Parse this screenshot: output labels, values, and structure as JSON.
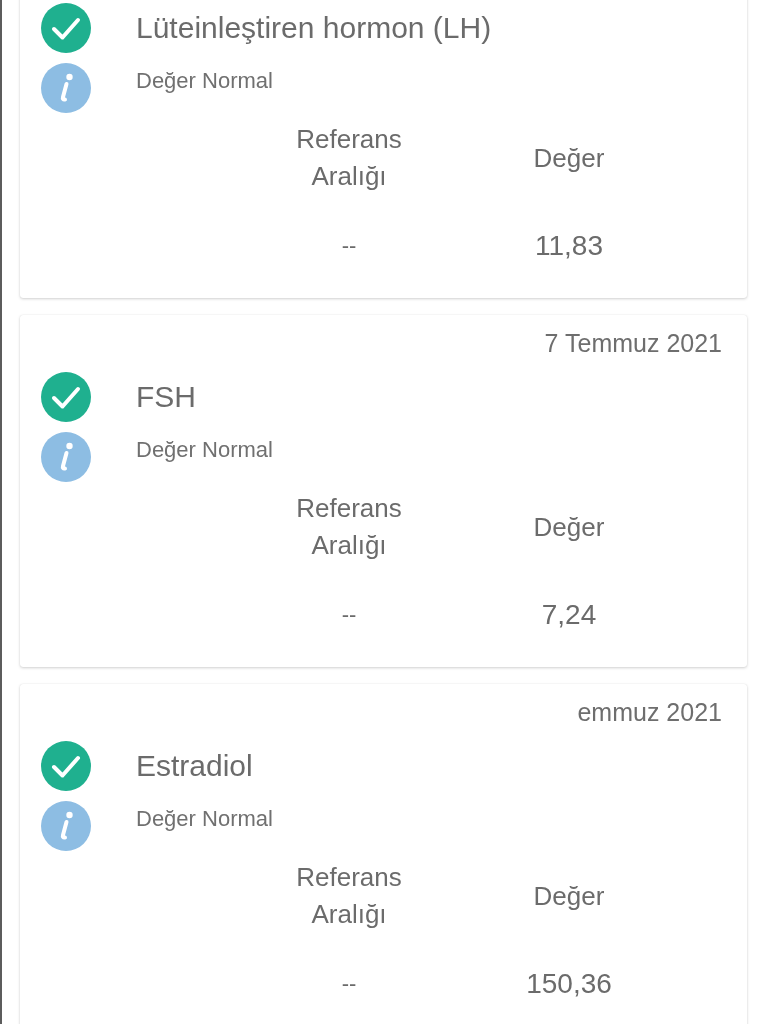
{
  "results": [
    {
      "name": "Lüteinleştiren hormon (LH)",
      "status": "Değer Normal",
      "columns": [
        "Referans Aralığı",
        "Değer"
      ],
      "reference": "--",
      "value": "11,83"
    },
    {
      "date": "7 Temmuz 2021",
      "name": "FSH",
      "status": "Değer Normal",
      "columns": [
        "Referans Aralığı",
        "Değer"
      ],
      "reference": "--",
      "value": "7,24"
    },
    {
      "date": "emmuz 2021",
      "name": "Estradiol",
      "status": "Değer Normal",
      "columns": [
        "Referans Aralığı",
        "Değer"
      ],
      "reference": "--",
      "value": "150,36"
    }
  ]
}
